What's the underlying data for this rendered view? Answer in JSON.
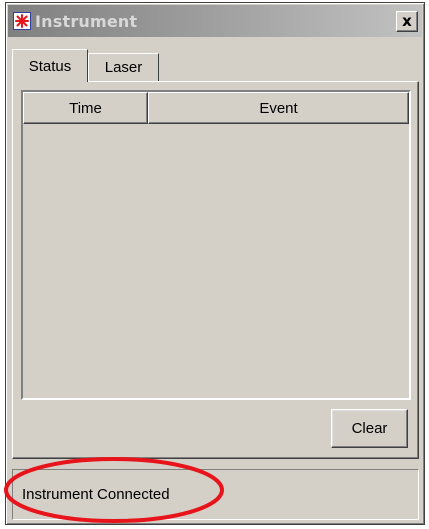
{
  "window": {
    "title": "Instrument",
    "close_label": "x",
    "app_icon": "laser-star-icon"
  },
  "tabs": [
    {
      "label": "Status",
      "active": true
    },
    {
      "label": "Laser",
      "active": false
    }
  ],
  "table": {
    "columns": [
      "Time",
      "Event"
    ],
    "rows": []
  },
  "buttons": {
    "clear_label": "Clear"
  },
  "status_bar": {
    "text": "Instrument Connected"
  },
  "colors": {
    "annotation": "#e8141b",
    "app_icon_star": "#e8141b",
    "app_icon_border": "#2f3fa0",
    "window_face": "#d4d0c8"
  }
}
